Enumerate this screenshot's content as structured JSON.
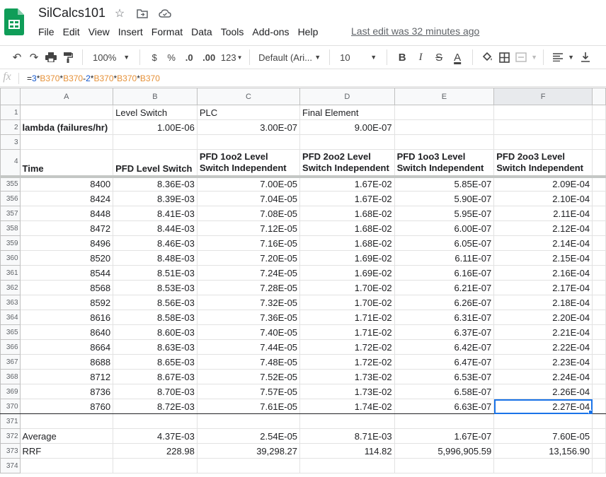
{
  "doc": {
    "title": "SilCalcs101",
    "last_edit": "Last edit was 32 minutes ago"
  },
  "title_icons": [
    "star-icon",
    "move-to-folder-icon",
    "cloud-status-icon"
  ],
  "menu": [
    "File",
    "Edit",
    "View",
    "Insert",
    "Format",
    "Data",
    "Tools",
    "Add-ons",
    "Help"
  ],
  "toolbar": {
    "zoom": "100%",
    "currency": "$",
    "percent": "%",
    "dec_decrease": ".0",
    "dec_increase": ".00",
    "more_formats": "123",
    "font": "Default (Ari...",
    "font_size": "10",
    "bold": "B",
    "italic": "I",
    "strike": "S",
    "text_color": "A",
    "accent": "#000000"
  },
  "formula_bar": {
    "fx": "fx",
    "parts": [
      "=",
      "3",
      "*",
      "B370",
      "*",
      "B370",
      "-",
      "2",
      "*",
      "B370",
      "*",
      "B370",
      "*",
      "B370"
    ]
  },
  "grid": {
    "columns": [
      "A",
      "B",
      "C",
      "D",
      "E",
      "F"
    ],
    "selected_column": "F",
    "row1": {
      "num": "1",
      "cells": [
        "",
        "Level Switch",
        "PLC",
        "Final Element",
        "",
        ""
      ]
    },
    "row2": {
      "num": "2",
      "cells": [
        "lambda (failures/hr)",
        "1.00E-06",
        "3.00E-07",
        "9.00E-07",
        "",
        ""
      ]
    },
    "row3": {
      "num": "3"
    },
    "row4": {
      "num": "4",
      "cells": [
        "Time",
        "PFD Level Switch",
        "PFD 1oo2 Level Switch Independent",
        "PFD 2oo2 Level Switch Independent",
        "PFD 1oo3 Level Switch Independent",
        "PFD 2oo3 Level Switch Independent"
      ]
    },
    "data_rows": [
      {
        "num": "355",
        "cells": [
          "8400",
          "8.36E-03",
          "7.00E-05",
          "1.67E-02",
          "5.85E-07",
          "2.09E-04"
        ]
      },
      {
        "num": "356",
        "cells": [
          "8424",
          "8.39E-03",
          "7.04E-05",
          "1.67E-02",
          "5.90E-07",
          "2.10E-04"
        ]
      },
      {
        "num": "357",
        "cells": [
          "8448",
          "8.41E-03",
          "7.08E-05",
          "1.68E-02",
          "5.95E-07",
          "2.11E-04"
        ]
      },
      {
        "num": "358",
        "cells": [
          "8472",
          "8.44E-03",
          "7.12E-05",
          "1.68E-02",
          "6.00E-07",
          "2.12E-04"
        ]
      },
      {
        "num": "359",
        "cells": [
          "8496",
          "8.46E-03",
          "7.16E-05",
          "1.68E-02",
          "6.05E-07",
          "2.14E-04"
        ]
      },
      {
        "num": "360",
        "cells": [
          "8520",
          "8.48E-03",
          "7.20E-05",
          "1.69E-02",
          "6.11E-07",
          "2.15E-04"
        ]
      },
      {
        "num": "361",
        "cells": [
          "8544",
          "8.51E-03",
          "7.24E-05",
          "1.69E-02",
          "6.16E-07",
          "2.16E-04"
        ]
      },
      {
        "num": "362",
        "cells": [
          "8568",
          "8.53E-03",
          "7.28E-05",
          "1.70E-02",
          "6.21E-07",
          "2.17E-04"
        ]
      },
      {
        "num": "363",
        "cells": [
          "8592",
          "8.56E-03",
          "7.32E-05",
          "1.70E-02",
          "6.26E-07",
          "2.18E-04"
        ]
      },
      {
        "num": "364",
        "cells": [
          "8616",
          "8.58E-03",
          "7.36E-05",
          "1.71E-02",
          "6.31E-07",
          "2.20E-04"
        ]
      },
      {
        "num": "365",
        "cells": [
          "8640",
          "8.60E-03",
          "7.40E-05",
          "1.71E-02",
          "6.37E-07",
          "2.21E-04"
        ]
      },
      {
        "num": "366",
        "cells": [
          "8664",
          "8.63E-03",
          "7.44E-05",
          "1.72E-02",
          "6.42E-07",
          "2.22E-04"
        ]
      },
      {
        "num": "367",
        "cells": [
          "8688",
          "8.65E-03",
          "7.48E-05",
          "1.72E-02",
          "6.47E-07",
          "2.23E-04"
        ]
      },
      {
        "num": "368",
        "cells": [
          "8712",
          "8.67E-03",
          "7.52E-05",
          "1.73E-02",
          "6.53E-07",
          "2.24E-04"
        ]
      },
      {
        "num": "369",
        "cells": [
          "8736",
          "8.70E-03",
          "7.57E-05",
          "1.73E-02",
          "6.58E-07",
          "2.26E-04"
        ]
      },
      {
        "num": "370",
        "cells": [
          "8760",
          "8.72E-03",
          "7.61E-05",
          "1.74E-02",
          "6.63E-07",
          "2.27E-04"
        ]
      }
    ],
    "row371": {
      "num": "371"
    },
    "row372": {
      "num": "372",
      "cells": [
        "Average",
        "4.37E-03",
        "2.54E-05",
        "8.71E-03",
        "1.67E-07",
        "7.60E-05"
      ]
    },
    "row373": {
      "num": "373",
      "cells": [
        "RRF",
        "228.98",
        "39,298.27",
        "114.82",
        "5,996,905.59",
        "13,156.90"
      ]
    },
    "row374": {
      "num": "374"
    }
  }
}
